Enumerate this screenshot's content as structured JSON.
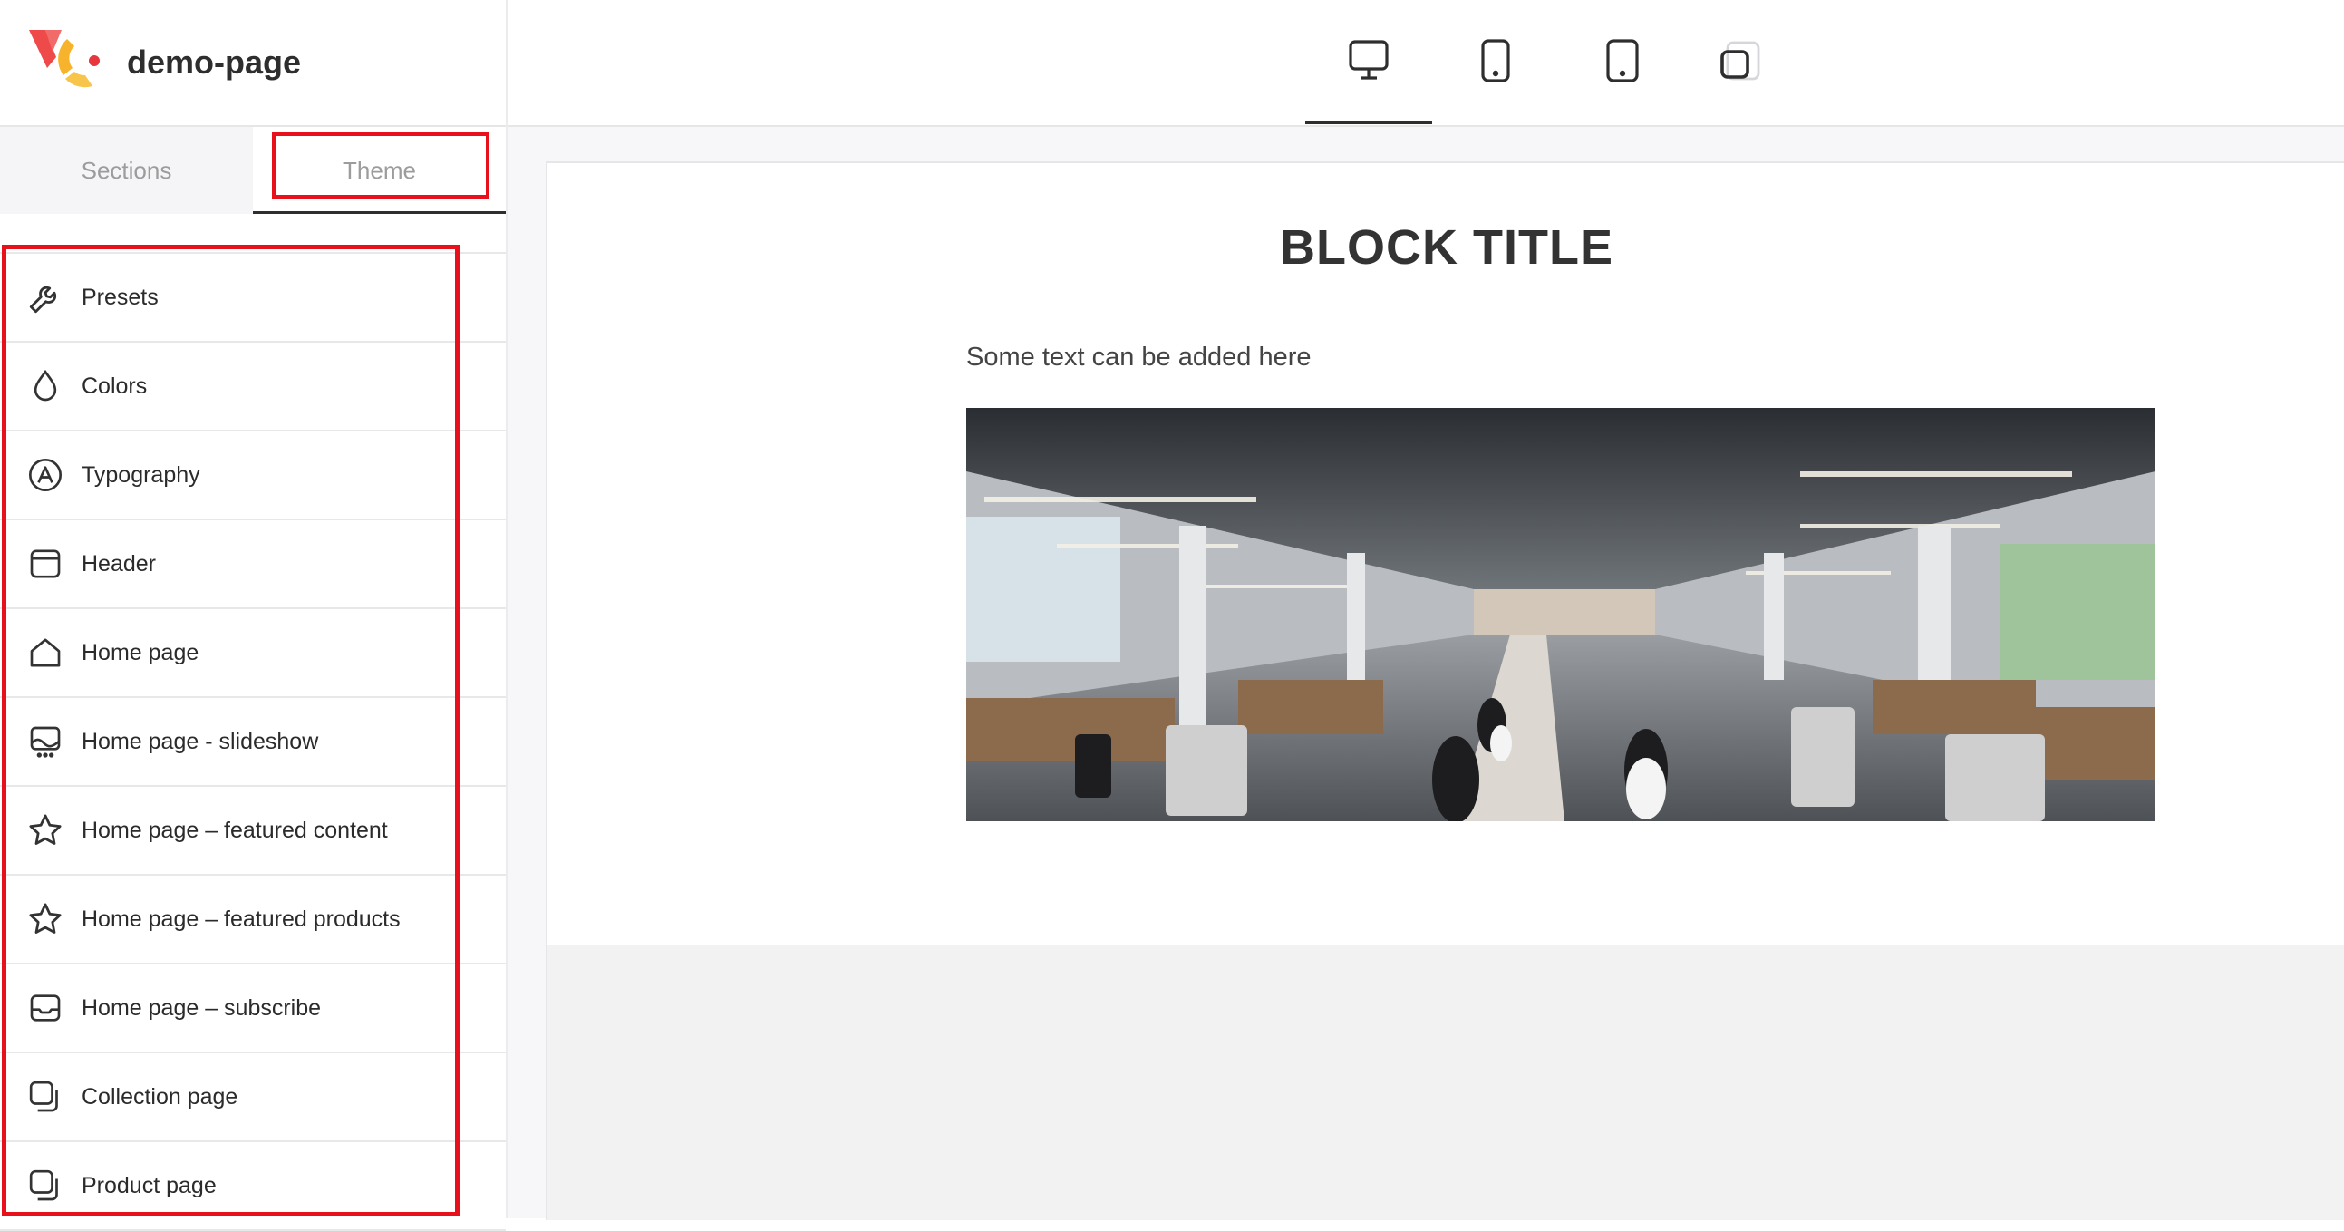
{
  "app": {
    "name": "demo-page"
  },
  "sidebar": {
    "tabs": [
      {
        "label": "Sections"
      },
      {
        "label": "Theme"
      }
    ],
    "active_tab": "Theme",
    "items": [
      {
        "label": "Presets",
        "icon": "wrench-icon"
      },
      {
        "label": "Colors",
        "icon": "drop-icon"
      },
      {
        "label": "Typography",
        "icon": "letter-a-circle-icon"
      },
      {
        "label": "Header",
        "icon": "window-header-icon"
      },
      {
        "label": "Home page",
        "icon": "home-icon"
      },
      {
        "label": "Home page - slideshow",
        "icon": "slideshow-icon"
      },
      {
        "label": "Home page – featured content",
        "icon": "star-icon"
      },
      {
        "label": "Home page – featured products",
        "icon": "star-icon"
      },
      {
        "label": "Home page – subscribe",
        "icon": "inbox-icon"
      },
      {
        "label": "Collection page",
        "icon": "stacked-squares-icon"
      },
      {
        "label": "Product page",
        "icon": "stacked-squares-icon"
      }
    ]
  },
  "devices": [
    {
      "name": "desktop",
      "icon": "desktop-icon",
      "active": true
    },
    {
      "name": "tablet",
      "icon": "tablet-icon",
      "active": false
    },
    {
      "name": "tablet-landscape",
      "icon": "tablet-icon",
      "active": false
    },
    {
      "name": "mobile",
      "icon": "mobile-icon",
      "active": false
    }
  ],
  "preview": {
    "block_title": "BLOCK TITLE",
    "block_text": "Some text can be added here",
    "image_alt": "office photo"
  },
  "colors": {
    "highlight": "#e8101b",
    "text": "#2b2b2b",
    "muted": "#9c9c9c"
  }
}
